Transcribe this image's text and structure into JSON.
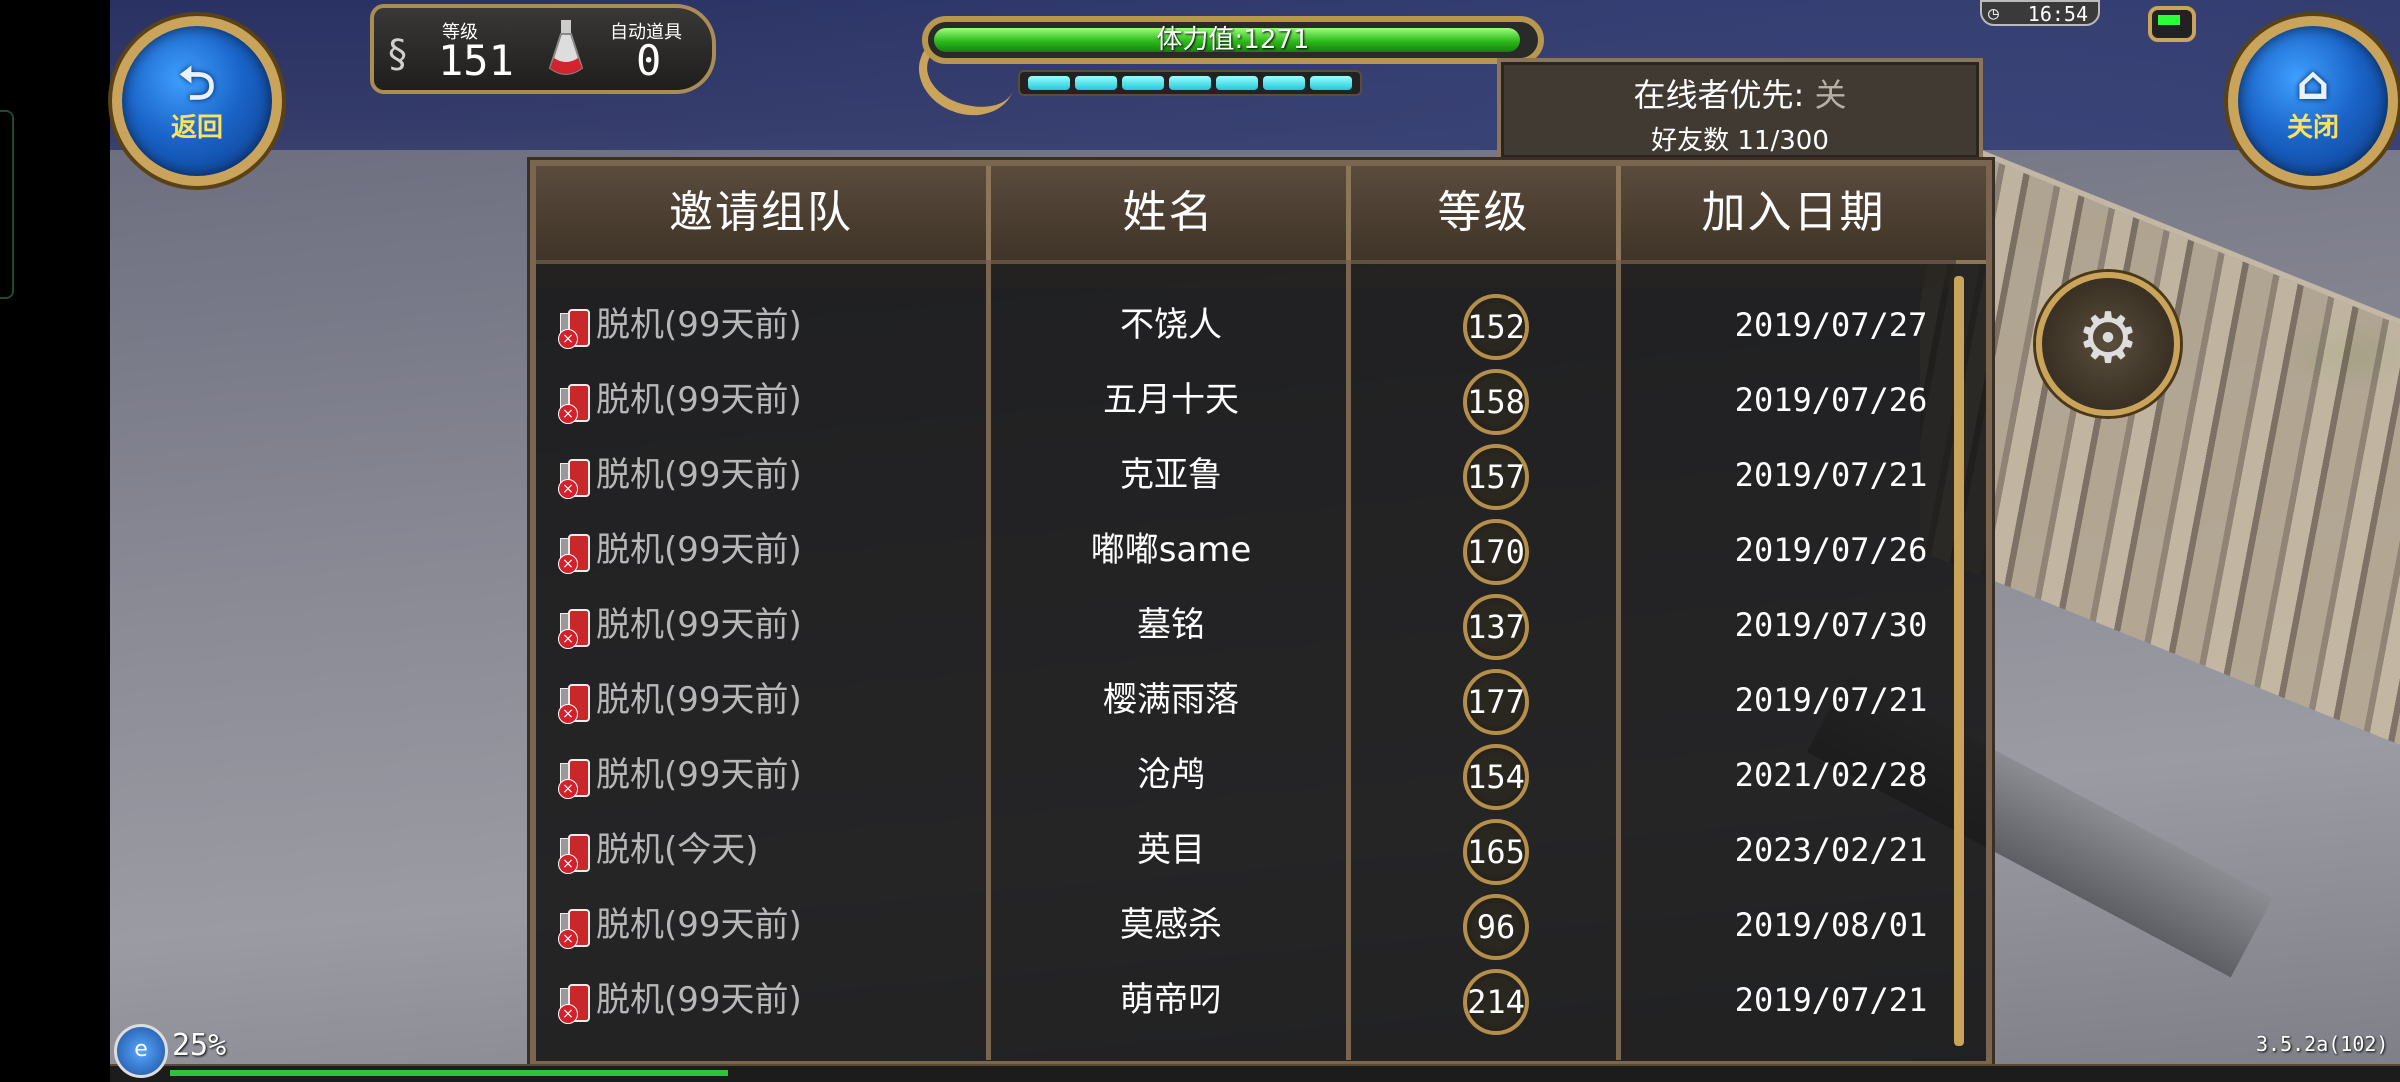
{
  "top": {
    "level_label": "等级",
    "level_value": "151",
    "auto_item_label": "自动道具",
    "auto_item_value": "0",
    "stamina_text": "体力值:1271",
    "stamina_fraction": 0.98,
    "stamina_pips": 7,
    "clock": "16:54",
    "back_label": "返回",
    "close_label": "关闭"
  },
  "friend_info": {
    "online_first_label": "在线者优先:",
    "online_first_value": "关",
    "friend_count": "好友数 11/300"
  },
  "table": {
    "headers": [
      "邀请组队",
      "姓名",
      "等级",
      "加入日期"
    ],
    "rows": [
      {
        "status": "脱机(99天前)",
        "name": "不饶人",
        "level": "152",
        "date": "2019/07/27"
      },
      {
        "status": "脱机(99天前)",
        "name": "五月十天",
        "level": "158",
        "date": "2019/07/26"
      },
      {
        "status": "脱机(99天前)",
        "name": "克亚鲁",
        "level": "157",
        "date": "2019/07/21"
      },
      {
        "status": "脱机(99天前)",
        "name": "嘟嘟same",
        "level": "170",
        "date": "2019/07/26"
      },
      {
        "status": "脱机(99天前)",
        "name": "墓铭",
        "level": "137",
        "date": "2019/07/30"
      },
      {
        "status": "脱机(99天前)",
        "name": "樱满雨落",
        "level": "177",
        "date": "2019/07/21"
      },
      {
        "status": "脱机(99天前)",
        "name": "沧鸬",
        "level": "154",
        "date": "2021/02/28"
      },
      {
        "status": "脱机(今天)",
        "name": "英目",
        "level": "165",
        "date": "2023/02/21"
      },
      {
        "status": "脱机(99天前)",
        "name": "莫感杀",
        "level": "96",
        "date": "2019/08/01"
      },
      {
        "status": "脱机(99天前)",
        "name": "萌帝叼",
        "level": "214",
        "date": "2019/07/21"
      }
    ]
  },
  "bottom": {
    "load_percent": "25%",
    "load_fraction": 0.25,
    "version": "3.5.2a(102)"
  },
  "icons": {
    "back": "back-arrow-icon",
    "close": "home-icon",
    "settings": "gear-icon",
    "status": "offline-phone-icon",
    "clock": "clock-icon",
    "battery": "battery-icon"
  },
  "colors": {
    "gold": "#c9a45a",
    "stamina_green": "#2dbb1c",
    "offline_text": "#b7b7b7",
    "button_blue": "#1a64c8"
  }
}
